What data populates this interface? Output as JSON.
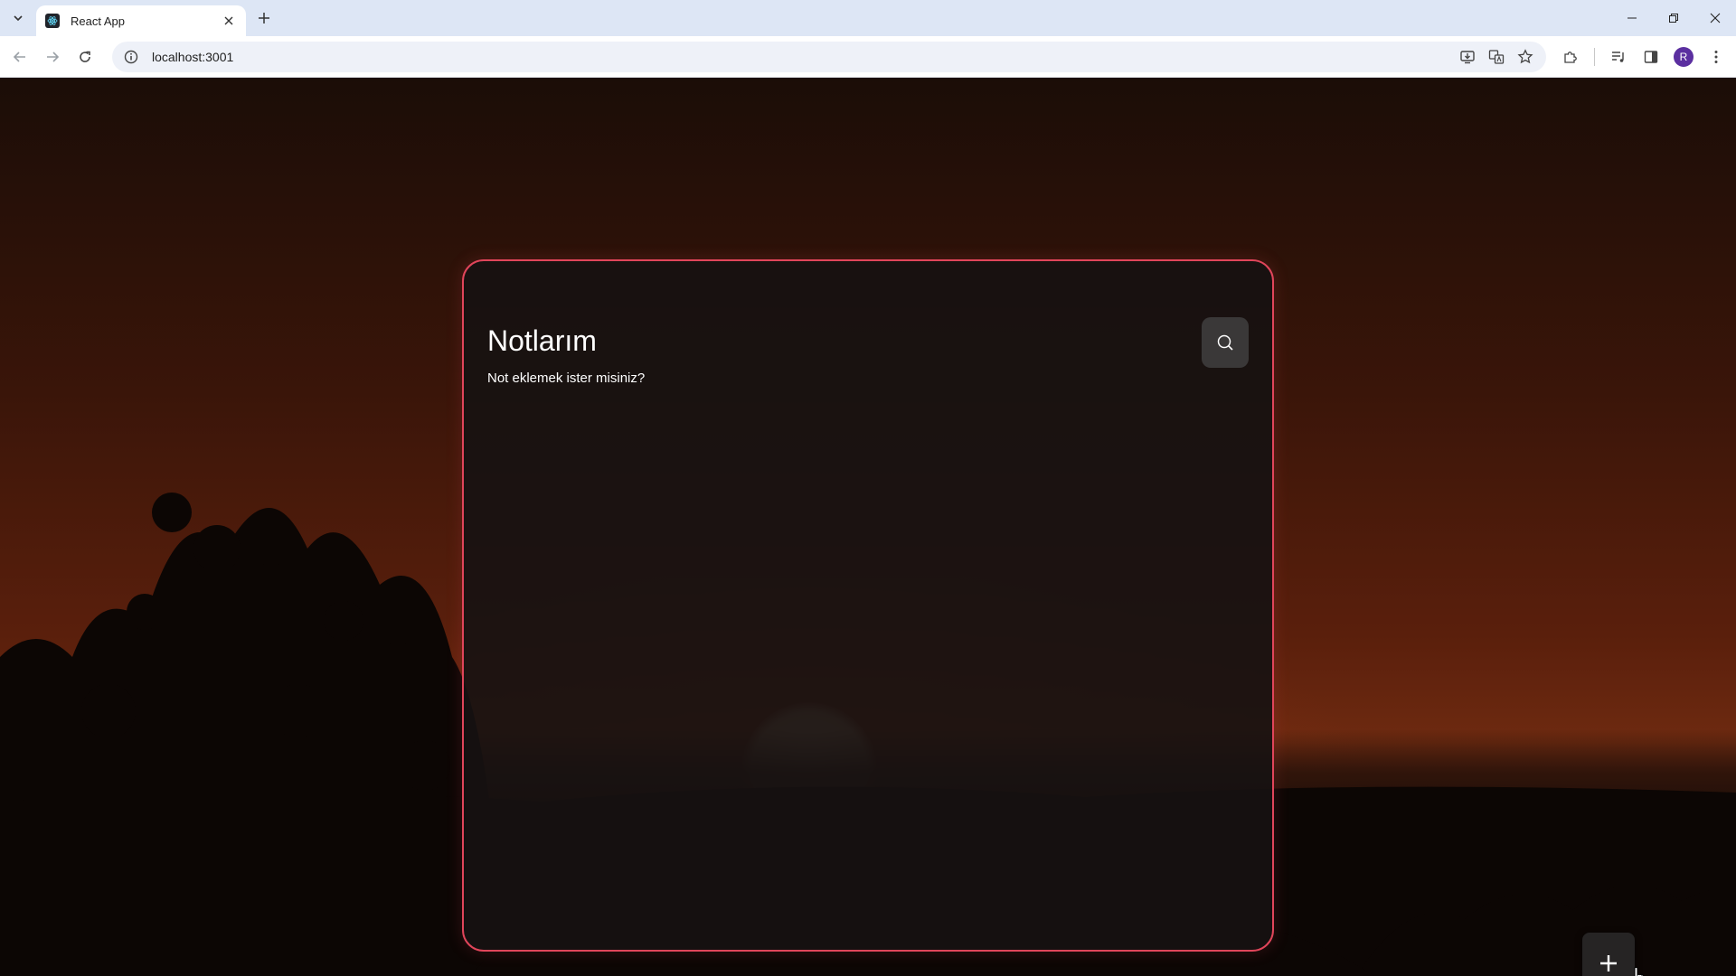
{
  "browser": {
    "tab": {
      "title": "React App"
    },
    "address": {
      "url": "localhost:3001"
    },
    "profile_initial": "R"
  },
  "app": {
    "title": "Notlarım",
    "subtitle": "Not eklemek ister misiniz?",
    "accent_color": "#e0455a",
    "icons": {
      "search": "search-icon",
      "add": "plus-icon"
    }
  }
}
